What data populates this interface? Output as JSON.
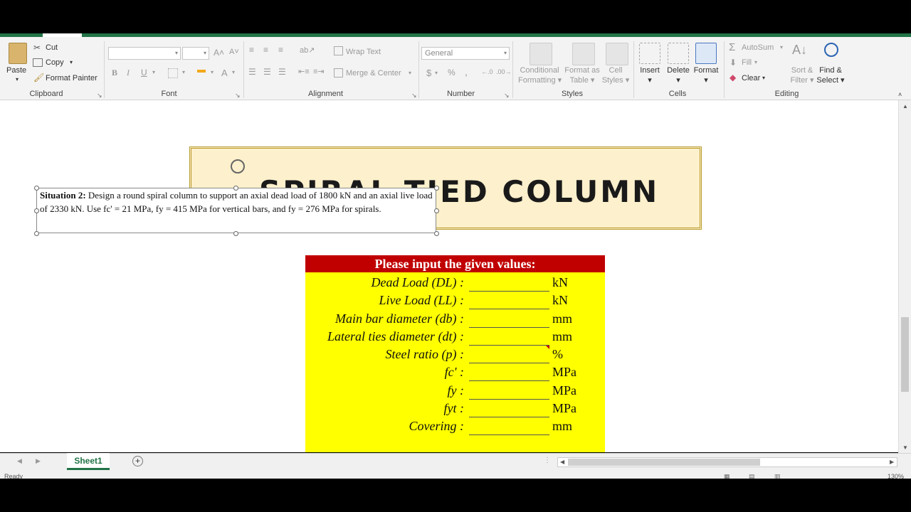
{
  "ribbon": {
    "clipboard": {
      "paste": "Paste",
      "cut": "Cut",
      "copy": "Copy",
      "format_painter": "Format Painter",
      "label": "Clipboard"
    },
    "font": {
      "label": "Font",
      "bold": "B",
      "italic": "I",
      "underline": "U"
    },
    "alignment": {
      "wrap_text": "Wrap Text",
      "merge_center": "Merge & Center",
      "label": "Alignment"
    },
    "number": {
      "format": "General",
      "currency": "$",
      "percent": "%",
      "comma": ",",
      "label": "Number"
    },
    "styles": {
      "conditional_formatting": [
        "Conditional",
        "Formatting"
      ],
      "format_as_table": [
        "Format as",
        "Table"
      ],
      "cell_styles": [
        "Cell",
        "Styles"
      ],
      "label": "Styles"
    },
    "cells": {
      "insert": "Insert",
      "delete": "Delete",
      "format": "Format",
      "label": "Cells"
    },
    "editing": {
      "autosum": "AutoSum",
      "fill": "Fill",
      "clear": "Clear",
      "sort_filter": [
        "Sort &",
        "Filter"
      ],
      "find_select": [
        "Find &",
        "Select"
      ],
      "label": "Editing"
    }
  },
  "sheet": {
    "banner_title": "SPIRAL TIED COLUMN",
    "textbox": {
      "heading": "Situation 2:",
      "body": "Design a round spiral column to support an axial dead load of 1800 kN and an axial live load of 2330 kN.  Use fc' = 21 MPa, fy = 415 MPa for vertical bars, and fy = 276 MPa for spirals."
    },
    "form": {
      "header": "Please input the given values:",
      "rows": [
        {
          "label": "Dead Load (DL) :",
          "unit": "kN",
          "value": ""
        },
        {
          "label": "Live Load (LL) :",
          "unit": "kN",
          "value": ""
        },
        {
          "label": "Main bar diameter (db) :",
          "unit": "mm",
          "value": ""
        },
        {
          "label": "Lateral ties diameter (dt) :",
          "unit": "mm",
          "value": ""
        },
        {
          "label": "Steel ratio (p) :",
          "unit": "%",
          "value": ""
        },
        {
          "label": "fc' :",
          "unit": "MPa",
          "value": ""
        },
        {
          "label": "fy :",
          "unit": "MPa",
          "value": ""
        },
        {
          "label": "fyt :",
          "unit": "MPa",
          "value": ""
        },
        {
          "label": "Covering :",
          "unit": "mm",
          "value": ""
        }
      ]
    }
  },
  "tabs": {
    "sheet1": "Sheet1",
    "add": "+"
  },
  "status": {
    "text": "Ready",
    "zoom": "130%"
  },
  "colors": {
    "excel_green": "#217346",
    "header_red": "#c00000",
    "form_yellow": "#ffff00",
    "banner_fill": "#fdf0cc"
  }
}
